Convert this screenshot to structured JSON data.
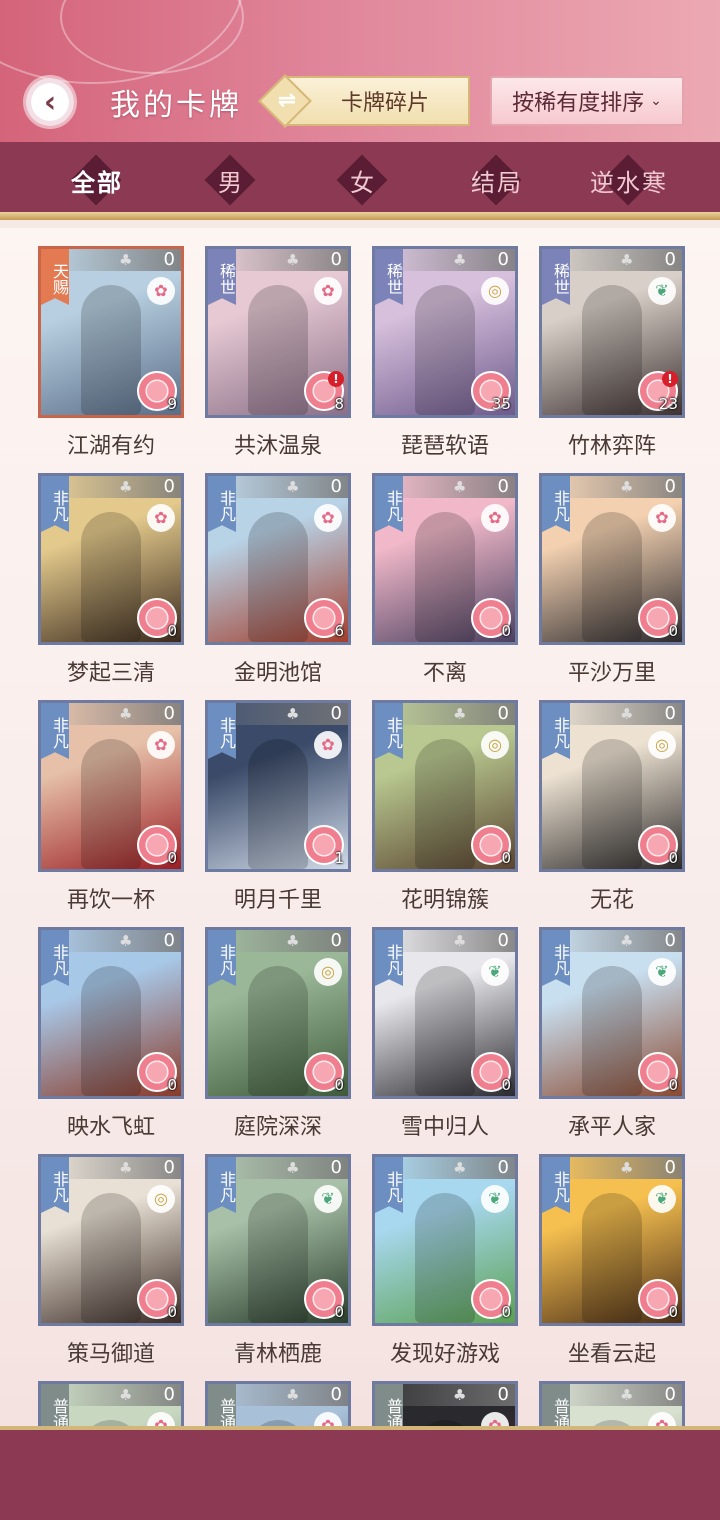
{
  "header": {
    "title": "我的卡牌",
    "fragments_label": "卡牌碎片",
    "sort_label": "按稀有度排序",
    "sort_chevron": "⌄"
  },
  "tabs": [
    {
      "label": "全部",
      "active": true
    },
    {
      "label": "男",
      "active": false
    },
    {
      "label": "女",
      "active": false
    },
    {
      "label": "结局",
      "active": false
    },
    {
      "label": "逆水寒",
      "active": false
    }
  ],
  "cards": [
    {
      "name": "江湖有约",
      "rarity": "天赐",
      "count": "0",
      "num": "9",
      "alert": false,
      "emblem": "plum",
      "c1": "#b7cfe0",
      "c2": "#5a6d88"
    },
    {
      "name": "共沐温泉",
      "rarity": "稀世",
      "count": "0",
      "num": "8",
      "alert": true,
      "emblem": "plum",
      "c1": "#e6c9d3",
      "c2": "#8a7088"
    },
    {
      "name": "琵琶软语",
      "rarity": "稀世",
      "count": "0",
      "num": "35",
      "alert": false,
      "emblem": "coin",
      "c1": "#d7c0dc",
      "c2": "#6e5a8c"
    },
    {
      "name": "竹林弈阵",
      "rarity": "稀世",
      "count": "0",
      "num": "23",
      "alert": true,
      "emblem": "leaf",
      "c1": "#d8d0c8",
      "c2": "#3e3232"
    },
    {
      "name": "梦起三清",
      "rarity": "非凡",
      "count": "0",
      "num": "0",
      "alert": false,
      "emblem": "plum",
      "c1": "#e3c98c",
      "c2": "#3a2a1e"
    },
    {
      "name": "金明池馆",
      "rarity": "非凡",
      "count": "0",
      "num": "6",
      "alert": false,
      "emblem": "plum",
      "c1": "#b8d2e6",
      "c2": "#a23f2e"
    },
    {
      "name": "不离",
      "rarity": "非凡",
      "count": "0",
      "num": "0",
      "alert": false,
      "emblem": "plum",
      "c1": "#f0b8c8",
      "c2": "#4b4060"
    },
    {
      "name": "平沙万里",
      "rarity": "非凡",
      "count": "0",
      "num": "0",
      "alert": false,
      "emblem": "plum",
      "c1": "#f2d0b0",
      "c2": "#2c2a2e"
    },
    {
      "name": "再饮一杯",
      "rarity": "非凡",
      "count": "0",
      "num": "0",
      "alert": false,
      "emblem": "plum",
      "c1": "#e6c0a8",
      "c2": "#9a1e24"
    },
    {
      "name": "明月千里",
      "rarity": "非凡",
      "count": "0",
      "num": "1",
      "alert": false,
      "emblem": "plum",
      "c1": "#3a4a68",
      "c2": "#d0dae8"
    },
    {
      "name": "花明锦簇",
      "rarity": "非凡",
      "count": "0",
      "num": "0",
      "alert": false,
      "emblem": "coin",
      "c1": "#b8c890",
      "c2": "#5a4430"
    },
    {
      "name": "无花",
      "rarity": "非凡",
      "count": "0",
      "num": "0",
      "alert": false,
      "emblem": "coin",
      "c1": "#ede2d2",
      "c2": "#2c2a2a"
    },
    {
      "name": "映水飞虹",
      "rarity": "非凡",
      "count": "0",
      "num": "0",
      "alert": false,
      "emblem": "none",
      "c1": "#a8c8e8",
      "c2": "#8a3a28"
    },
    {
      "name": "庭院深深",
      "rarity": "非凡",
      "count": "0",
      "num": "0",
      "alert": false,
      "emblem": "coin",
      "c1": "#9ab898",
      "c2": "#3e5a3a"
    },
    {
      "name": "雪中归人",
      "rarity": "非凡",
      "count": "0",
      "num": "0",
      "alert": false,
      "emblem": "leaf",
      "c1": "#e8e8ec",
      "c2": "#2a2a30"
    },
    {
      "name": "承平人家",
      "rarity": "非凡",
      "count": "0",
      "num": "0",
      "alert": false,
      "emblem": "leaf",
      "c1": "#c8dff0",
      "c2": "#8a4a32"
    },
    {
      "name": "策马御道",
      "rarity": "非凡",
      "count": "0",
      "num": "0",
      "alert": false,
      "emblem": "coin",
      "c1": "#e8e0d4",
      "c2": "#3a2a24"
    },
    {
      "name": "青林栖鹿",
      "rarity": "非凡",
      "count": "0",
      "num": "0",
      "alert": false,
      "emblem": "leaf",
      "c1": "#a8c0a8",
      "c2": "#2a3e2c"
    },
    {
      "name": "发现好游戏",
      "rarity": "非凡",
      "count": "0",
      "num": "0",
      "alert": false,
      "emblem": "leaf",
      "c1": "#a8d8f0",
      "c2": "#5aa050"
    },
    {
      "name": "坐看云起",
      "rarity": "非凡",
      "count": "0",
      "num": "0",
      "alert": false,
      "emblem": "leaf",
      "c1": "#f6c050",
      "c2": "#4a2e18"
    },
    {
      "name": "",
      "rarity": "普通",
      "count": "0",
      "num": "",
      "alert": false,
      "emblem": "plum",
      "c1": "#c8d8c0",
      "c2": "#4a6a4a"
    },
    {
      "name": "",
      "rarity": "普通",
      "count": "0",
      "num": "",
      "alert": false,
      "emblem": "plum",
      "c1": "#a8c0d8",
      "c2": "#3a4a6a"
    },
    {
      "name": "",
      "rarity": "普通",
      "count": "0",
      "num": "",
      "alert": false,
      "emblem": "plum",
      "c1": "#2a2a2e",
      "c2": "#8a1c20"
    },
    {
      "name": "",
      "rarity": "普通",
      "count": "0",
      "num": "",
      "alert": false,
      "emblem": "plum",
      "c1": "#d8e0d0",
      "c2": "#6a6a5a"
    }
  ],
  "colors": {
    "header_start": "#d4647a",
    "filter_bar": "#8c3a53",
    "tab_diamond": "#5a1d33",
    "card_border": "#6e7aa0"
  }
}
